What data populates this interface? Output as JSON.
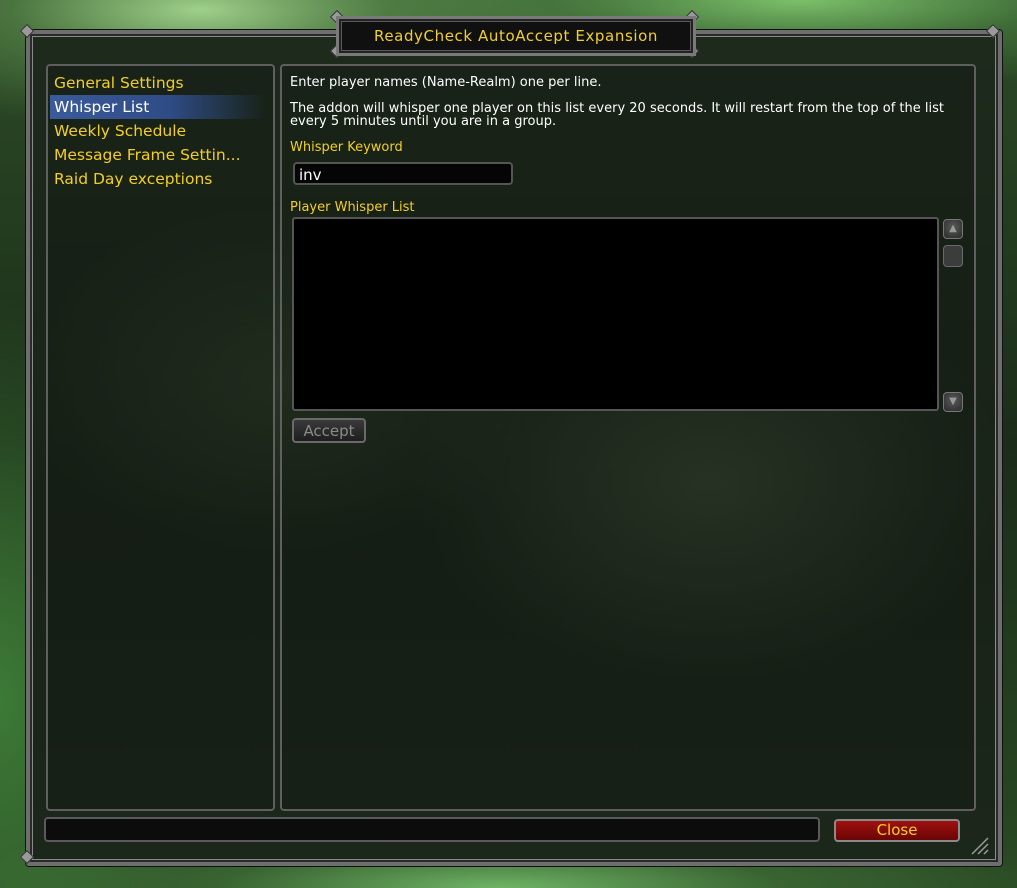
{
  "window": {
    "title": "ReadyCheck AutoAccept Expansion"
  },
  "sidebar": {
    "items": [
      {
        "label": "General Settings",
        "selected": false
      },
      {
        "label": "Whisper List",
        "selected": true
      },
      {
        "label": "Weekly Schedule",
        "selected": false
      },
      {
        "label": "Message Frame Settin...",
        "selected": false
      },
      {
        "label": "Raid Day exceptions",
        "selected": false
      }
    ]
  },
  "main": {
    "intro_line": "Enter player names (Name-Realm) one per line.",
    "explain_line_1": "The addon will whisper one player on this list every 20 seconds. It will restart from the top of the list",
    "explain_line_2": "every 5 minutes until you are in a group.",
    "keyword_label": "Whisper Keyword",
    "keyword_value": "inv",
    "list_label": "Player Whisper List",
    "list_value": "",
    "accept_label": "Accept"
  },
  "footer": {
    "status_text": "",
    "close_label": "Close"
  },
  "colors": {
    "gold_text": "#f3cf22",
    "selected_bg": "#3a5a9a",
    "close_button": "#a01010"
  }
}
